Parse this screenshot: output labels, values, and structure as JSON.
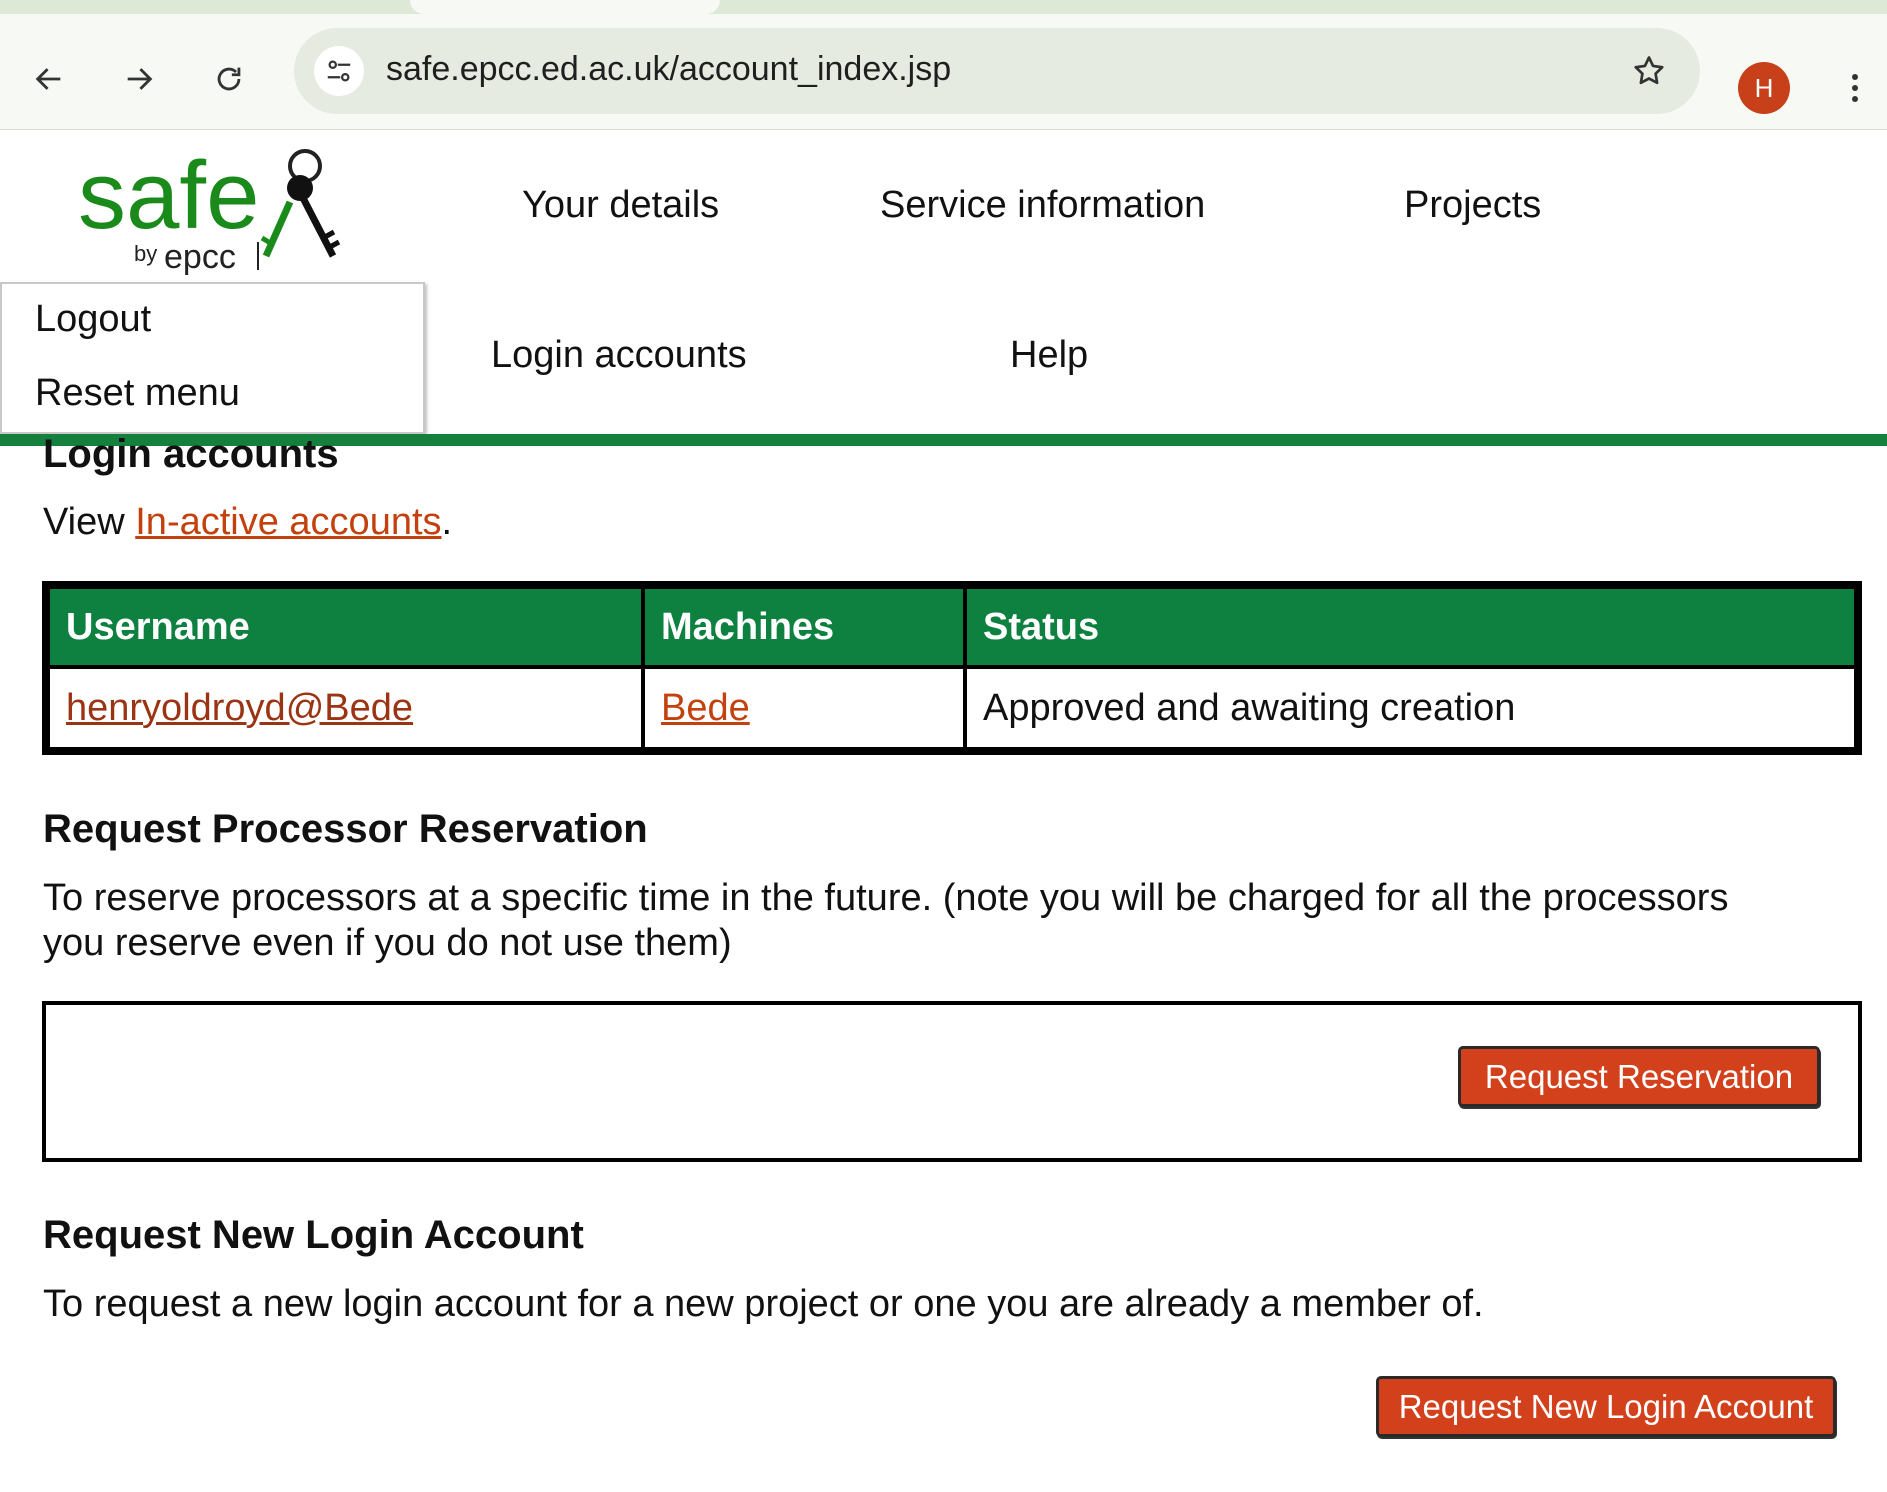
{
  "browser": {
    "url": "safe.epcc.ed.ac.uk/account_index.jsp",
    "profile_initial": "H"
  },
  "logo": {
    "word": "safe",
    "by": "by",
    "org": "epcc"
  },
  "nav": {
    "your_details": "Your details",
    "service_information": "Service information",
    "projects": "Projects",
    "login_accounts": "Login accounts",
    "help": "Help"
  },
  "dropdown": {
    "logout": "Logout",
    "reset_menu": "Reset menu"
  },
  "login_accounts": {
    "heading": "Login accounts",
    "view_prefix": "View ",
    "inactive_link": "In-active accounts",
    "view_suffix": ".",
    "columns": [
      "Username",
      "Machines",
      "Status"
    ],
    "rows": [
      {
        "username": "henryoldroyd@Bede",
        "machine": "Bede",
        "status": "Approved and awaiting creation"
      }
    ]
  },
  "reservation": {
    "heading": "Request Processor Reservation",
    "line1": "To reserve processors at a specific time in the future. (note you will be charged for all the processors",
    "line2": "you reserve even if you do not use them)",
    "button": "Request Reservation"
  },
  "new_account": {
    "heading": "Request New Login Account",
    "text": "To request a new login account for a new project or one you are already a member of.",
    "button": "Request New Login Account"
  },
  "colors": {
    "brand_green": "#15803d",
    "table_header": "#0e8040",
    "button": "#d2401c",
    "link": "#c2410c"
  }
}
